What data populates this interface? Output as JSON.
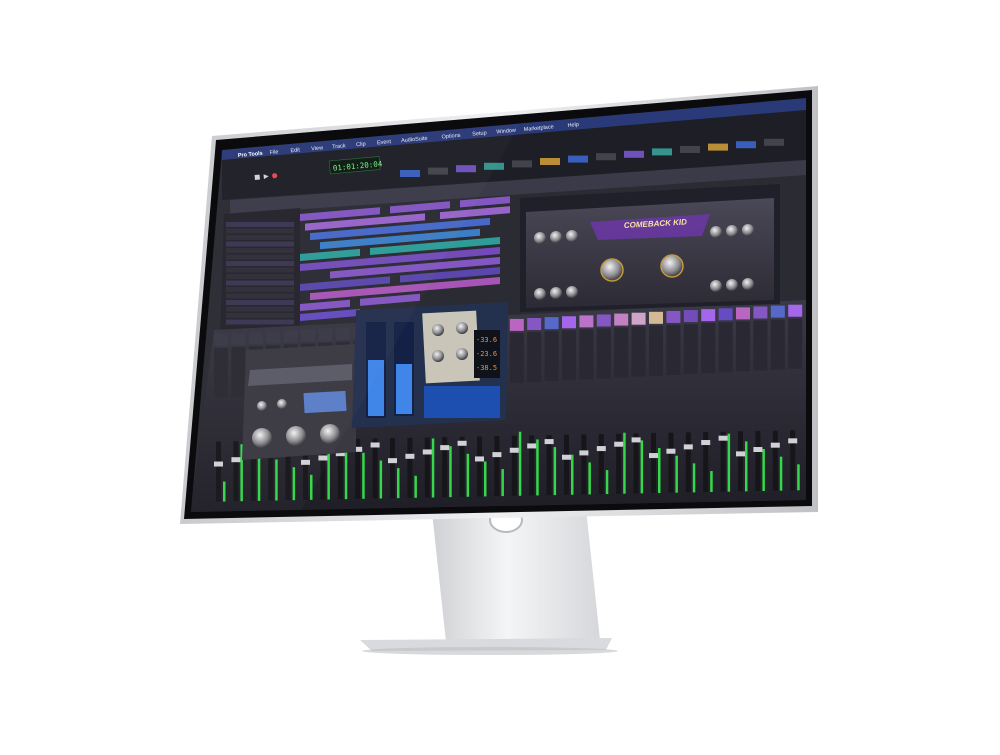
{
  "colors": {
    "background": "#ffffff",
    "bezel": "#0b0b0d",
    "frame": "#d9dadc",
    "app_bg": "#2b2b33",
    "track_purple": "#8e5bd0",
    "track_blue": "#4a6fd8",
    "track_teal": "#2fa8a2",
    "meter_green": "#34d84a",
    "plugin_purple": "#b36bff"
  },
  "menubar": {
    "app_name": "Pro Tools",
    "items": [
      "File",
      "Edit",
      "View",
      "Track",
      "Clip",
      "Event",
      "AudioSuite",
      "Options",
      "Setup",
      "Window",
      "Marketplace",
      "Help"
    ]
  },
  "transport": {
    "main_counter": "01:01:20:04"
  },
  "plugins": {
    "comeback_kid": {
      "title": "COMEBACK KID"
    },
    "limiter": {
      "readout_1": "-33.6",
      "readout_2": "-23.6",
      "readout_3": "-38.5"
    }
  },
  "icons": {
    "apple_logo": "apple-icon",
    "play": "play-icon",
    "stop": "stop-icon",
    "record": "record-icon",
    "stand_cutout": "cable-hole-icon"
  }
}
